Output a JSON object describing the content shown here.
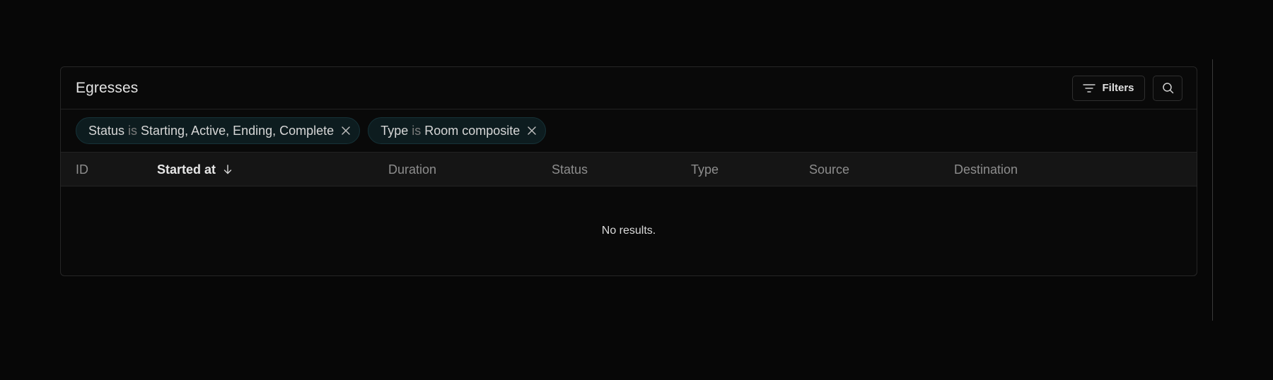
{
  "card": {
    "title": "Egresses",
    "filters_label": "Filters"
  },
  "filters": [
    {
      "field": "Status",
      "operator": "is",
      "value": "Starting, Active, Ending, Complete"
    },
    {
      "field": "Type",
      "operator": "is",
      "value": "Room composite"
    }
  ],
  "table": {
    "columns": [
      "ID",
      "Started at",
      "Duration",
      "Status",
      "Type",
      "Source",
      "Destination"
    ],
    "sorted_column": "Started at",
    "sort_direction": "descending",
    "empty_text": "No results."
  },
  "icons": {
    "filters": "filter-lines-icon",
    "search": "search-icon",
    "remove_filter": "close-icon",
    "sort": "arrow-down-icon"
  },
  "colors": {
    "background": "#070707",
    "chip_background": "#0d1c1f",
    "chip_border": "#163238",
    "header_row": "#151515"
  }
}
